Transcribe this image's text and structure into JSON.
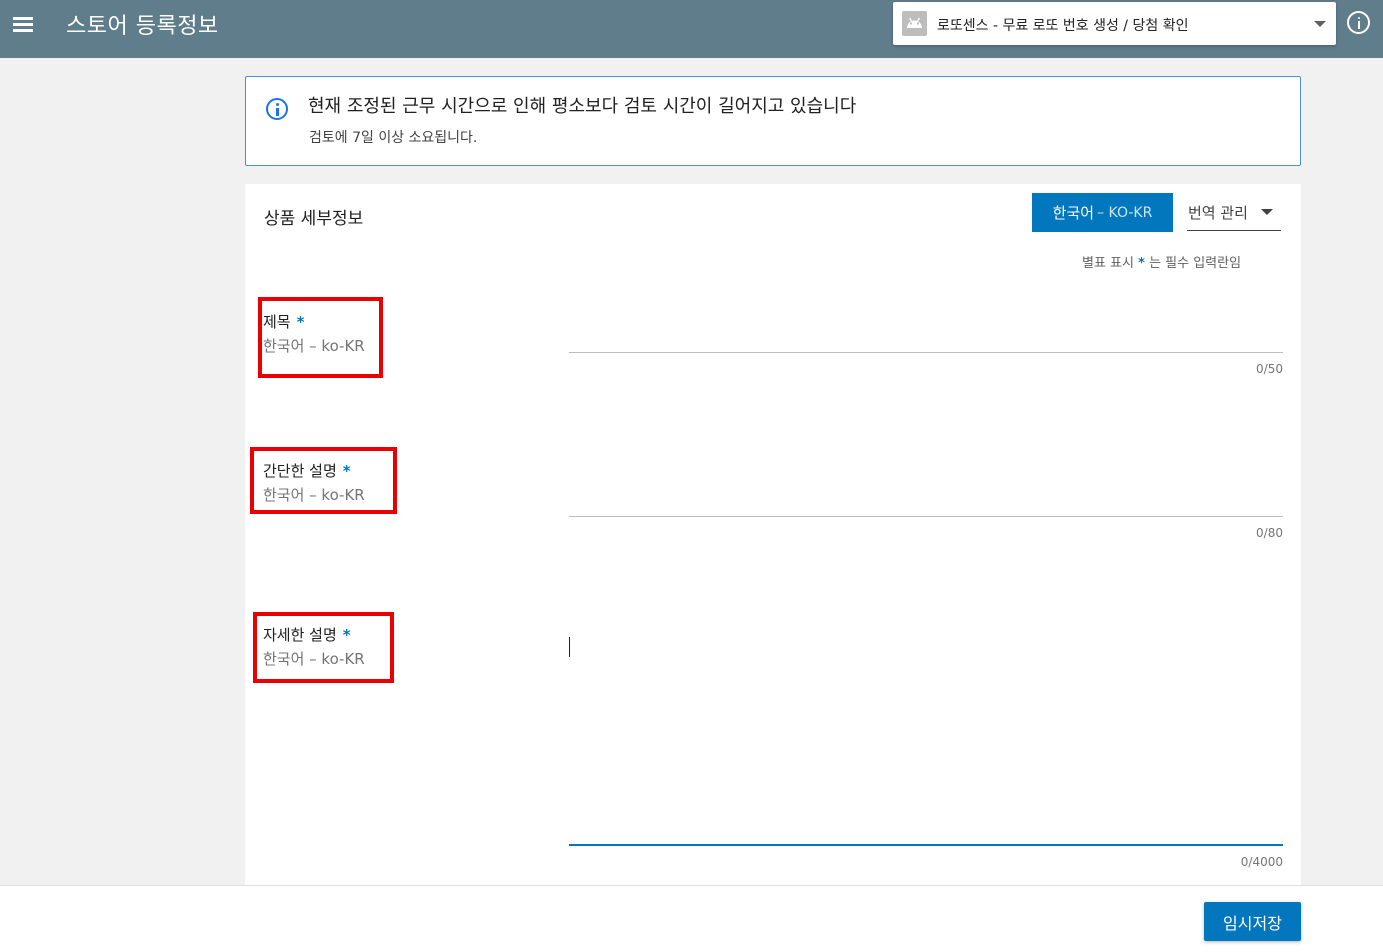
{
  "header": {
    "title": "스토어 등록정보",
    "app_name": "로또센스 - 무료 로또 번호 생성 / 당첨 확인",
    "icons": {
      "menu": "menu-icon",
      "app": "android-icon",
      "caret": "dropdown-caret-icon",
      "info": "info-icon"
    }
  },
  "notice": {
    "title": "현재 조정된 근무 시간으로 인해 평소보다 검토 시간이 길어지고 있습니다",
    "subtitle": "검토에 7일 이상 소요됩니다.",
    "icon": "info-icon"
  },
  "card": {
    "title": "상품 세부정보",
    "language_button": {
      "name": "한국어",
      "code": "– KO-KR"
    },
    "translation_select": "번역 관리",
    "required_note_prefix": "별표 표시",
    "required_note_star": "*",
    "required_note_suffix": "는 필수 입력란임"
  },
  "fields": [
    {
      "label": "제목",
      "star": "*",
      "locale": "한국어 – ko-KR",
      "value": "",
      "counter": "0/50"
    },
    {
      "label": "간단한 설명",
      "star": "*",
      "locale": "한국어 – ko-KR",
      "value": "",
      "counter": "0/80"
    },
    {
      "label": "자세한 설명",
      "star": "*",
      "locale": "한국어 – ko-KR",
      "value": "",
      "counter": "0/4000"
    }
  ],
  "footer": {
    "save_label": "임시저장"
  },
  "colors": {
    "topbar": "#607d8b",
    "accent": "#0277bd",
    "highlight": "#ea0000",
    "notice_border": "#4a90d9"
  }
}
